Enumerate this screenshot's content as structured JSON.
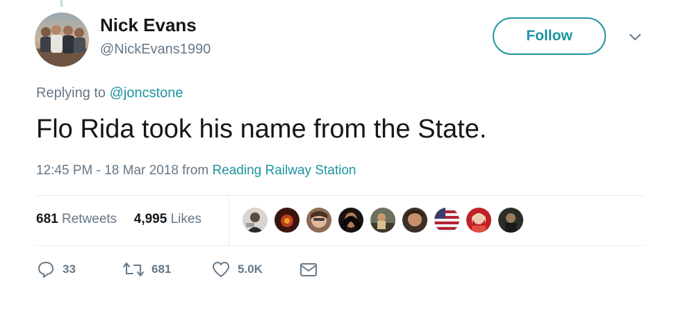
{
  "author": {
    "name": "Nick Evans",
    "handle": "@NickEvans1990",
    "avatar_icon": "group-photo-avatar"
  },
  "follow_button": {
    "label": "Follow"
  },
  "menu": {
    "icon": "chevron-down-icon"
  },
  "reply": {
    "prefix": "Replying to ",
    "to": "@joncstone"
  },
  "tweet": {
    "text": "Flo Rida took his name from the State."
  },
  "meta": {
    "time": "12:45 PM - 18 Mar 2018 from ",
    "location": "Reading Railway Station"
  },
  "stats": {
    "retweets_count": "681",
    "retweets_label": " Retweets",
    "likes_count": "4,995",
    "likes_label": " Likes"
  },
  "likers": [
    {
      "name": "liker-avatar-1"
    },
    {
      "name": "liker-avatar-2"
    },
    {
      "name": "liker-avatar-3"
    },
    {
      "name": "liker-avatar-4"
    },
    {
      "name": "liker-avatar-5"
    },
    {
      "name": "liker-avatar-6"
    },
    {
      "name": "liker-avatar-7"
    },
    {
      "name": "liker-avatar-8"
    },
    {
      "name": "liker-avatar-9"
    }
  ],
  "actions": {
    "reply_count": "33",
    "retweet_count": "681",
    "like_count": "5.0K",
    "reply_icon": "reply-icon",
    "retweet_icon": "retweet-icon",
    "like_icon": "heart-icon",
    "dm_icon": "envelope-icon"
  },
  "colors": {
    "accent": "#1c94a0",
    "secondary_text": "#657786",
    "primary_text": "#14171a",
    "divider": "#e6ecf0"
  }
}
